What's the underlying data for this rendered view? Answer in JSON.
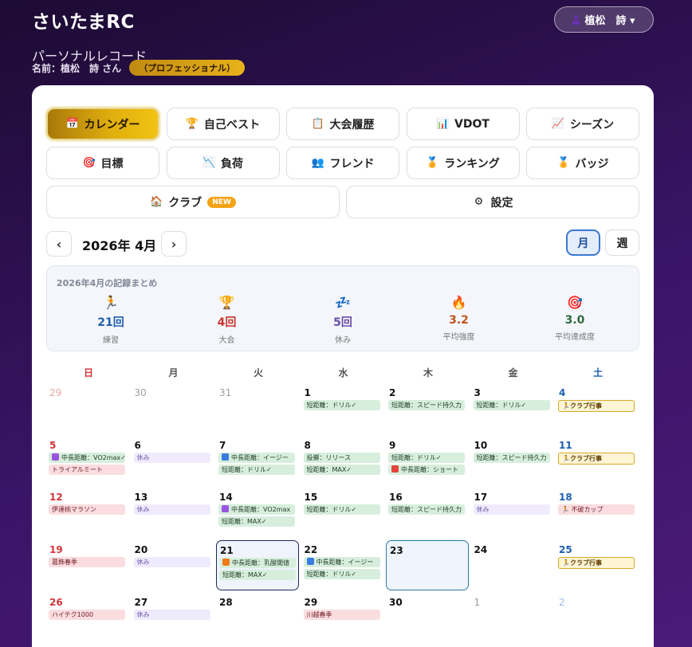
{
  "header": {
    "app_title": "さいたまRC",
    "subtitle": "パーソナルレコード",
    "name_line": "名前：植松　詩 さん",
    "rank_badge": "（プロフェッショナル）",
    "user_button": "植松　詩 ▾"
  },
  "tabs": [
    {
      "label": "カレンダー",
      "icon": "calendar-icon",
      "glyph": "📅",
      "active": true
    },
    {
      "label": "自己ベスト",
      "icon": "trophy-icon",
      "glyph": "🏆"
    },
    {
      "label": "大会履歴",
      "icon": "clipboard-icon",
      "glyph": "📋"
    },
    {
      "label": "VDOT",
      "icon": "bar-chart-icon",
      "glyph": "📊"
    },
    {
      "label": "シーズン",
      "icon": "line-chart-icon",
      "glyph": "📈"
    },
    {
      "label": "目標",
      "icon": "target-icon",
      "glyph": "🎯"
    },
    {
      "label": "負荷",
      "icon": "chart-down-icon",
      "glyph": "📉"
    },
    {
      "label": "フレンド",
      "icon": "friends-icon",
      "glyph": "👥"
    },
    {
      "label": "ランキング",
      "icon": "medal-icon",
      "glyph": "🏅"
    },
    {
      "label": "バッジ",
      "icon": "badge-icon",
      "glyph": "🏅"
    },
    {
      "label": "クラブ",
      "icon": "house-icon",
      "glyph": "🏠",
      "badge": "NEW"
    },
    {
      "label": "設定",
      "icon": "gear-icon",
      "glyph": "⚙"
    }
  ],
  "calendar": {
    "prev": "‹",
    "next": "›",
    "month_title": "2026年 4月",
    "view_month": "月",
    "view_week": "週",
    "weekdays": [
      "日",
      "月",
      "火",
      "水",
      "木",
      "金",
      "土"
    ]
  },
  "summary": {
    "title": "2026年4月の記録まとめ",
    "stats": [
      {
        "icon": "runner-icon",
        "glyph": "🏃",
        "value": "21回",
        "label": "練習",
        "color": "#1f5fb0"
      },
      {
        "icon": "trophy-icon",
        "glyph": "🏆",
        "value": "4回",
        "label": "大会",
        "color": "#c8352c"
      },
      {
        "icon": "sleep-icon",
        "glyph": "💤",
        "value": "5回",
        "label": "休み",
        "color": "#6b4ea6"
      },
      {
        "icon": "fire-icon",
        "glyph": "🔥",
        "value": "3.2",
        "label": "平均強度",
        "color": "#c2531c"
      },
      {
        "icon": "target-icon",
        "glyph": "🎯",
        "value": "3.0",
        "label": "平均達成度",
        "color": "#2f6b3c"
      }
    ]
  },
  "weeks": [
    [
      {
        "d": "29",
        "other": true,
        "events": []
      },
      {
        "d": "30",
        "other": true,
        "events": []
      },
      {
        "d": "31",
        "other": true,
        "events": []
      },
      {
        "d": "1",
        "events": [
          {
            "t": "training",
            "text": "短距離：ドリル✓"
          }
        ]
      },
      {
        "d": "2",
        "events": [
          {
            "t": "training",
            "text": "短距離：スピード持久力"
          }
        ]
      },
      {
        "d": "3",
        "events": [
          {
            "t": "training",
            "text": "短距離：ドリル✓"
          }
        ]
      },
      {
        "d": "4",
        "events": [
          {
            "t": "club",
            "text": "🏃クラブ行事"
          }
        ]
      }
    ],
    [
      {
        "d": "5",
        "events": [
          {
            "t": "training",
            "text": "中長距離：VO2max✓",
            "sq": "#9a55e0"
          },
          {
            "t": "race",
            "text": "トライアルミート"
          }
        ]
      },
      {
        "d": "6",
        "events": [
          {
            "t": "rest",
            "text": "休み"
          }
        ]
      },
      {
        "d": "7",
        "events": [
          {
            "t": "training",
            "text": "中長距離：イージー",
            "sq": "#3a7be0"
          },
          {
            "t": "training",
            "text": "短距離：ドリル✓"
          }
        ]
      },
      {
        "d": "8",
        "events": [
          {
            "t": "training",
            "text": "投擲：リリース"
          },
          {
            "t": "training",
            "text": "短距離：MAX✓"
          }
        ]
      },
      {
        "d": "9",
        "events": [
          {
            "t": "training",
            "text": "短距離：ドリル✓"
          },
          {
            "t": "training",
            "text": "中長距離：ショート",
            "sq": "#e0453a"
          }
        ]
      },
      {
        "d": "10",
        "events": [
          {
            "t": "training",
            "text": "短距離：スピード持久力"
          }
        ]
      },
      {
        "d": "11",
        "events": [
          {
            "t": "club",
            "text": "🏃クラブ行事"
          }
        ]
      }
    ],
    [
      {
        "d": "12",
        "events": [
          {
            "t": "race",
            "text": "伊達桃マラソン"
          }
        ]
      },
      {
        "d": "13",
        "events": [
          {
            "t": "rest",
            "text": "休み"
          }
        ]
      },
      {
        "d": "14",
        "events": [
          {
            "t": "training",
            "text": "中長距離：VO2max",
            "sq": "#9a55e0"
          },
          {
            "t": "training",
            "text": "短距離：MAX✓"
          }
        ]
      },
      {
        "d": "15",
        "events": [
          {
            "t": "training",
            "text": "短距離：ドリル✓"
          }
        ]
      },
      {
        "d": "16",
        "events": [
          {
            "t": "training",
            "text": "短距離：スピード持久力"
          }
        ]
      },
      {
        "d": "17",
        "events": [
          {
            "t": "rest",
            "text": "休み"
          }
        ]
      },
      {
        "d": "18",
        "events": [
          {
            "t": "race",
            "text": "🏃 不破カップ"
          }
        ]
      }
    ],
    [
      {
        "d": "19",
        "events": [
          {
            "t": "race",
            "text": "葛飾春季"
          }
        ]
      },
      {
        "d": "20",
        "events": [
          {
            "t": "rest",
            "text": "休み"
          }
        ]
      },
      {
        "d": "21",
        "selected": true,
        "events": [
          {
            "t": "training",
            "text": "中長距離：乳酸閾値",
            "sq": "#f07a16"
          },
          {
            "t": "training",
            "text": "短距離：MAX✓"
          }
        ]
      },
      {
        "d": "22",
        "events": [
          {
            "t": "training",
            "text": "中長距離：イージー",
            "sq": "#3a7be0"
          },
          {
            "t": "training",
            "text": "短距離：ドリル✓"
          }
        ]
      },
      {
        "d": "23",
        "today": true,
        "events": []
      },
      {
        "d": "24",
        "events": []
      },
      {
        "d": "25",
        "events": [
          {
            "t": "club",
            "text": "🏃クラブ行事"
          }
        ]
      }
    ],
    [
      {
        "d": "26",
        "events": [
          {
            "t": "race",
            "text": "ハイテク1000"
          }
        ]
      },
      {
        "d": "27",
        "events": [
          {
            "t": "rest",
            "text": "休み"
          }
        ]
      },
      {
        "d": "28",
        "events": []
      },
      {
        "d": "29",
        "events": [
          {
            "t": "race",
            "text": "川越春季"
          }
        ]
      },
      {
        "d": "30",
        "events": []
      },
      {
        "d": "1",
        "other": true,
        "events": []
      },
      {
        "d": "2",
        "other": true,
        "events": []
      }
    ]
  ]
}
